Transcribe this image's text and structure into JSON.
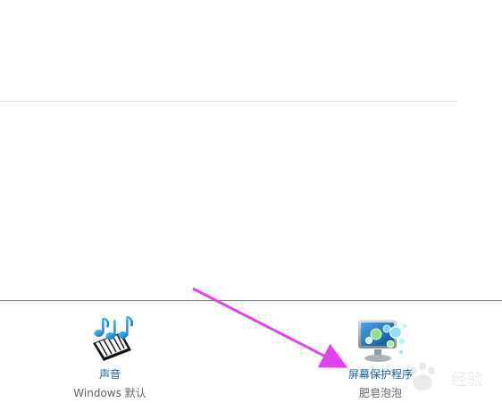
{
  "personalization_settings": {
    "sound": {
      "label": "声音",
      "value": "Windows 默认"
    },
    "screen_saver": {
      "label": "屏幕保护程序",
      "value": "肥皂泡泡"
    }
  },
  "annotation": {
    "arrow_color": "#df42ef"
  },
  "watermark": {
    "icon": "paw-icon",
    "text": "经验"
  }
}
